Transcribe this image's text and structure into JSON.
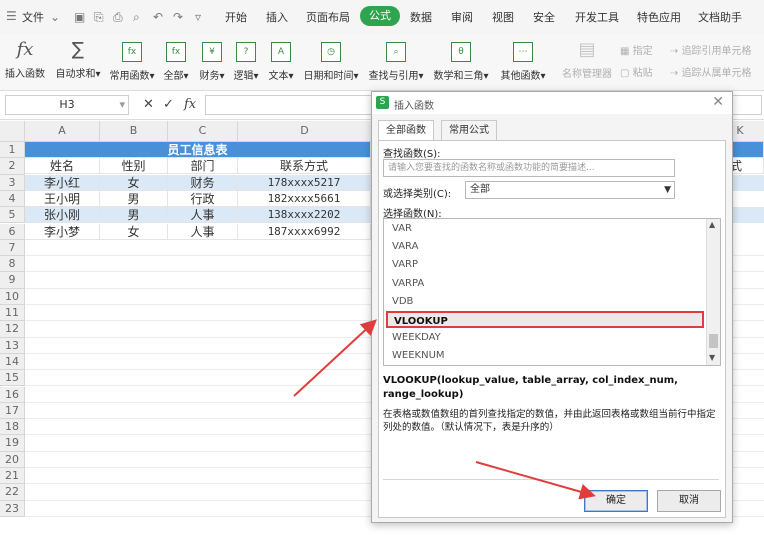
{
  "menubar": {
    "file_label": "文件",
    "tabs": [
      "开始",
      "插入",
      "页面布局",
      "公式",
      "数据",
      "审阅",
      "视图",
      "安全",
      "开发工具",
      "特色应用",
      "文档助手"
    ],
    "active_tab": "公式",
    "accent_color": "#2ea44f"
  },
  "ribbon": {
    "insert_function": "插入函数",
    "autosum": "自动求和",
    "common_functions": "常用函数",
    "all": "全部",
    "finance": "财务",
    "logic": "逻辑",
    "text": "文本",
    "datetime": "日期和时间",
    "lookup": "查找与引用",
    "math": "数学和三角",
    "other": "其他函数",
    "name_manager": "名称管理器",
    "specify": "指定",
    "paste": "粘贴",
    "trace_precedents": "追踪引用单元格",
    "trace_dependents": "追踪从属单元格"
  },
  "formula_bar": {
    "name_box": "H3",
    "cancel_icon": "✕",
    "confirm_icon": "✓",
    "fx_label": "fx"
  },
  "sheet": {
    "columns": [
      "A",
      "B",
      "C",
      "D",
      "K"
    ],
    "rows": [
      "1",
      "2",
      "3",
      "4",
      "5",
      "6",
      "7",
      "8",
      "9",
      "10",
      "11",
      "12",
      "13",
      "14",
      "15",
      "16",
      "17",
      "18",
      "19",
      "20",
      "21",
      "22",
      "23"
    ],
    "title": "员工信息表",
    "headers": [
      "姓名",
      "性别",
      "部门",
      "联系方式"
    ],
    "partial_header_k": "式",
    "data": [
      [
        "李小红",
        "女",
        "财务",
        "178xxxx5217"
      ],
      [
        "王小明",
        "男",
        "行政",
        "182xxxx5661"
      ],
      [
        "张小刚",
        "男",
        "人事",
        "138xxxx2202"
      ],
      [
        "李小梦",
        "女",
        "人事",
        "187xxxx6992"
      ]
    ],
    "header_fill": "#4a90d9",
    "alt_row_fill": "#dbe9f6"
  },
  "dialog": {
    "title": "插入函数",
    "tab_all": "全部函数",
    "tab_common": "常用公式",
    "search_label": "查找函数(S):",
    "search_placeholder": "请输入您要查找的函数名称或函数功能的简要描述...",
    "category_label": "或选择类别(C):",
    "category_value": "全部",
    "select_label": "选择函数(N):",
    "functions": [
      "VAR",
      "VARA",
      "VARP",
      "VARPA",
      "VDB",
      "VLOOKUP",
      "WEEKDAY",
      "WEEKNUM"
    ],
    "selected_function": "VLOOKUP",
    "signature": "VLOOKUP(lookup_value, table_array, col_index_num, range_lookup)",
    "description": "在表格或数值数组的首列查找指定的数值，并由此返回表格或数组当前行中指定列处的数值。（默认情况下，表是升序的）",
    "ok": "确定",
    "cancel": "取消",
    "highlight_color": "#e03c3c"
  }
}
